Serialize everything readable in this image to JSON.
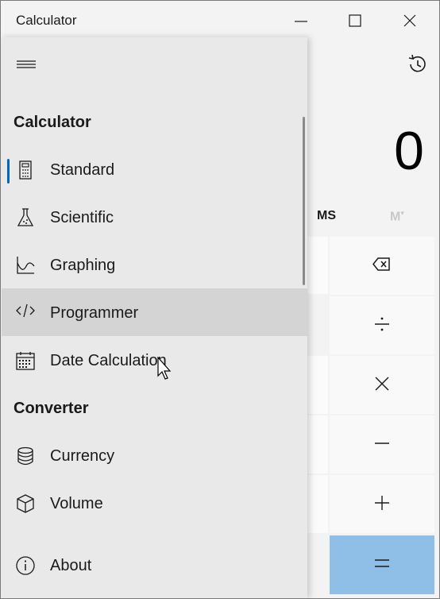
{
  "window": {
    "title": "Calculator"
  },
  "display": {
    "value": "0"
  },
  "memory": {
    "ms": "MS",
    "mv": "M"
  },
  "nav": {
    "header_calculator": "Calculator",
    "header_converter": "Converter",
    "items": [
      {
        "label": "Standard",
        "icon": "calculator-icon",
        "selected": true
      },
      {
        "label": "Scientific",
        "icon": "flask-icon"
      },
      {
        "label": "Graphing",
        "icon": "graph-icon"
      },
      {
        "label": "Programmer",
        "icon": "code-icon",
        "hovered": true
      },
      {
        "label": "Date Calculation",
        "icon": "calendar-icon"
      }
    ],
    "converters": [
      {
        "label": "Currency",
        "icon": "coins-icon"
      },
      {
        "label": "Volume",
        "icon": "cube-icon"
      }
    ],
    "about": {
      "label": "About",
      "icon": "info-icon"
    }
  },
  "colors": {
    "accent": "#0067c0",
    "equals": "#8fbee6",
    "hover": "#d4d4d4"
  }
}
